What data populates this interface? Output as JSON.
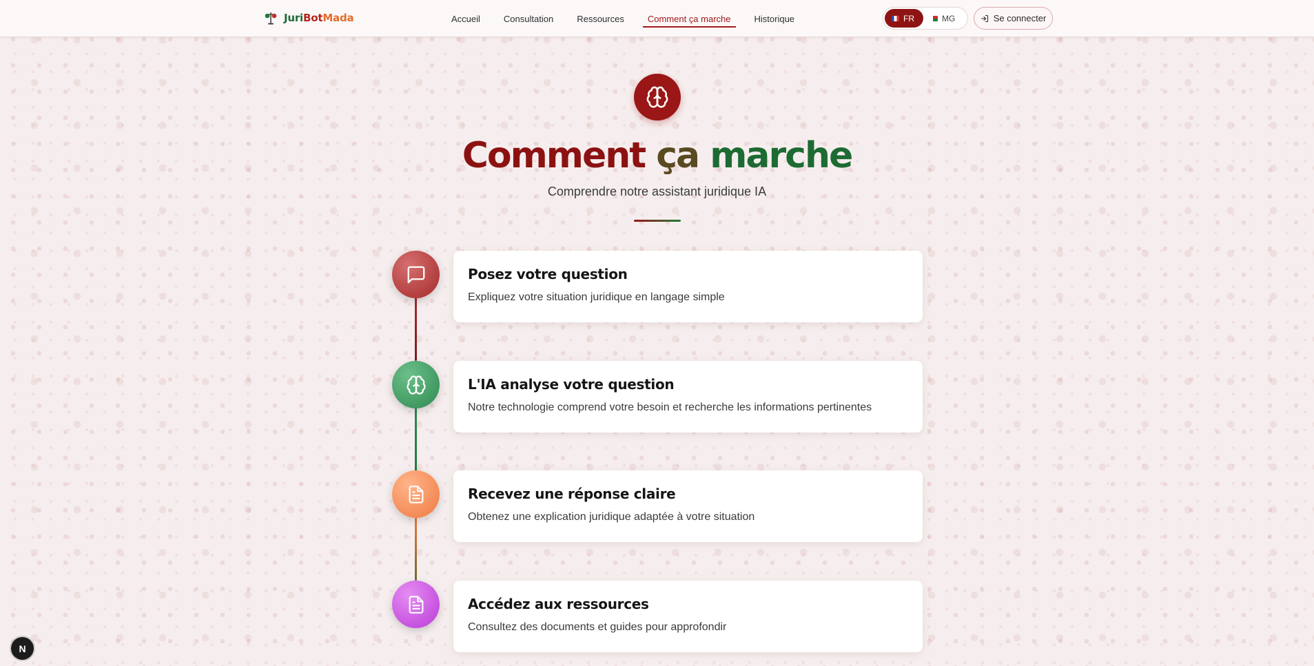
{
  "brand": {
    "part1": "Juri",
    "part2": "Bot",
    "part3": "Mada",
    "icon": "scales-of-justice-icon"
  },
  "nav": {
    "items": [
      {
        "label": "Accueil"
      },
      {
        "label": "Consultation"
      },
      {
        "label": "Ressources"
      },
      {
        "label": "Comment ça marche"
      },
      {
        "label": "Historique"
      }
    ],
    "active_index": 3
  },
  "language": {
    "options": [
      {
        "code": "FR",
        "flag": "france-flag-icon"
      },
      {
        "code": "MG",
        "flag": "madagascar-flag-icon"
      }
    ],
    "selected": "FR"
  },
  "auth": {
    "login_label": "Se connecter",
    "icon": "login-icon"
  },
  "hero": {
    "icon": "brain-icon",
    "title_part1": "Comment",
    "title_part2": "ça",
    "title_part3": "marche",
    "subtitle": "Comprendre notre assistant juridique IA"
  },
  "steps": [
    {
      "title": "Posez votre question",
      "description": "Expliquez votre situation juridique en langage simple",
      "icon": "message-square-icon"
    },
    {
      "title": "L'IA analyse votre question",
      "description": "Notre technologie comprend votre besoin et recherche les informations pertinentes",
      "icon": "brain-icon"
    },
    {
      "title": "Recevez une réponse claire",
      "description": "Obtenez une explication juridique adaptée à votre situation",
      "icon": "file-text-icon"
    },
    {
      "title": "Accédez aux ressources",
      "description": "Consultez des documents et guides pour approfondir",
      "icon": "file-text-icon"
    }
  ],
  "colors": {
    "primary_red": "#9b1616",
    "primary_green": "#1f7a3a",
    "step1": "#a42b2b",
    "step2": "#2f8a50",
    "step3": "#ef7a41",
    "step4": "#b93bd7"
  },
  "dev_badge": {
    "label": "N",
    "icon": "next-dev-indicator-icon"
  }
}
